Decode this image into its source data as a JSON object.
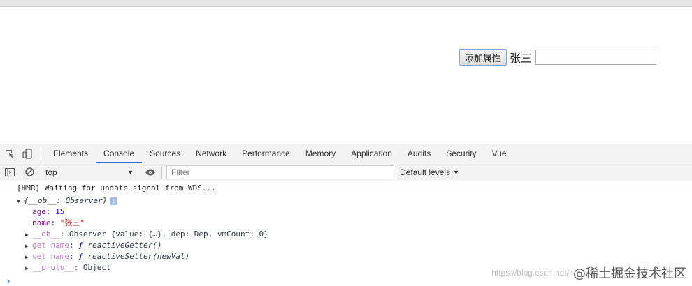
{
  "page": {
    "button_label": "添加属性",
    "name_text": "张三",
    "input_value": ""
  },
  "devtools": {
    "tabs": [
      "Elements",
      "Console",
      "Sources",
      "Network",
      "Performance",
      "Memory",
      "Application",
      "Audits",
      "Security",
      "Vue"
    ],
    "active_tab": "Console",
    "context": "top",
    "filter_placeholder": "Filter",
    "levels": "Default levels"
  },
  "console": {
    "hmr_message": "[HMR] Waiting for update signal from WDS...",
    "object_summary": "{__ob__: Observer}",
    "info_badge": "i",
    "props": {
      "age_key": "age",
      "age_value": "15",
      "name_key": "name",
      "name_value": "\"张三\"",
      "ob_key": "__ob__",
      "ob_value": "Observer {value: {…}, dep: Dep, vmCount: 0}",
      "ob_vmcount": "0",
      "getter_key": "get name",
      "getter_f": "ƒ",
      "getter_value": "reactiveGetter()",
      "setter_key": "set name",
      "setter_f": "ƒ",
      "setter_value": "reactiveSetter(newVal)",
      "proto_key": "__proto__",
      "proto_value": "Object"
    },
    "prompt": "›"
  },
  "watermark": {
    "csdn": "https://blog.csdn.net/",
    "juejin": "@稀土掘金技术社区"
  },
  "colors": {
    "accent": "#1a73e8",
    "key_purple": "#881391",
    "string_red": "#c41a16",
    "number_blue": "#1c00cf"
  }
}
